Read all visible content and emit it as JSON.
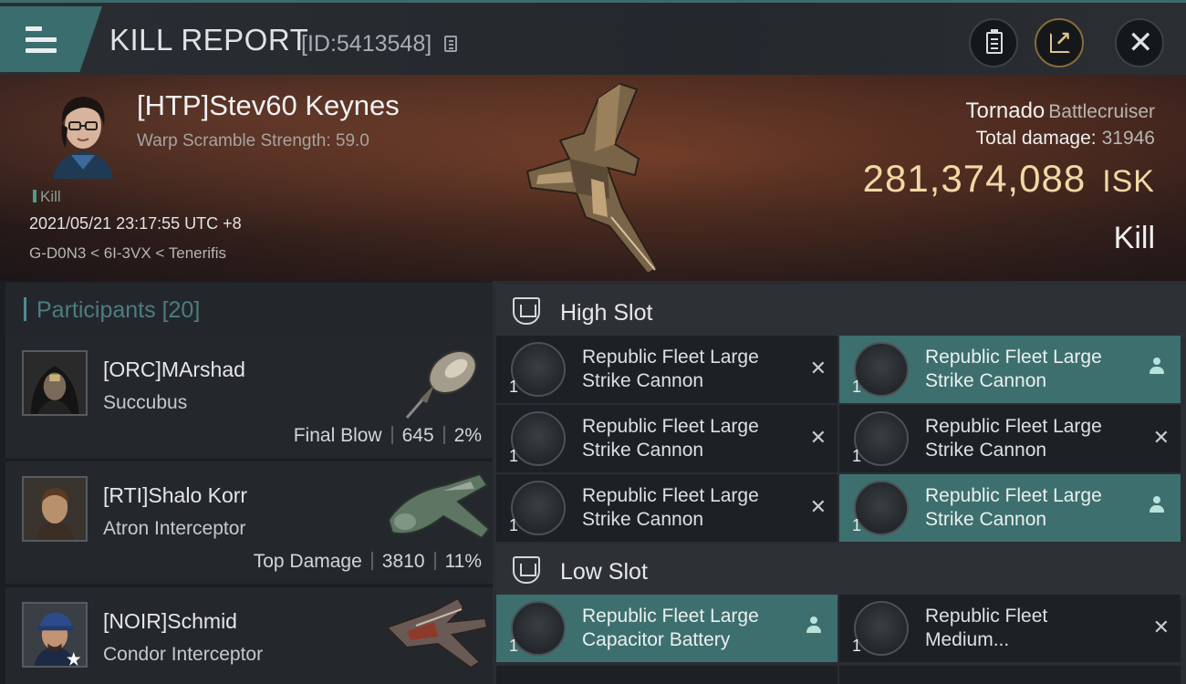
{
  "header": {
    "title": "KILL REPORT",
    "report_id": "[ID:5413548]"
  },
  "victim": {
    "pilot_name": "[HTP]Stev60 Keynes",
    "warp_scramble": "Warp Scramble Strength: 59.0",
    "tag": "Kill",
    "datetime": "2021/05/21 23:17:55 UTC +8",
    "location": "G-D0N3 < 6I-3VX < Tenerifis",
    "ship_name": "Tornado",
    "ship_class": "Battlecruiser",
    "total_damage_label": "Total damage:",
    "total_damage_value": "31946",
    "isk_value": "281,374,088",
    "isk_unit": "ISK",
    "result": "Kill"
  },
  "participants": {
    "label": "Participants",
    "count": "[20]",
    "rows": [
      {
        "name": "[ORC]MArshad",
        "ship": "Succubus",
        "role": "Final Blow",
        "damage": "645",
        "percent": "2%"
      },
      {
        "name": "[RTI]Shalo Korr",
        "ship": "Atron Interceptor",
        "role": "Top Damage",
        "damage": "3810",
        "percent": "11%"
      },
      {
        "name": "[NOIR]Schmid",
        "ship": "Condor Interceptor",
        "role": "",
        "damage": "",
        "percent": ""
      }
    ]
  },
  "fittings": {
    "high_slot": {
      "label": "High Slot",
      "modules": [
        {
          "name": "Republic Fleet Large Strike Cannon",
          "qty": "1",
          "state": "destroyed"
        },
        {
          "name": "Republic Fleet Large Strike Cannon",
          "qty": "1",
          "state": "dropped"
        },
        {
          "name": "Republic Fleet Large Strike Cannon",
          "qty": "1",
          "state": "destroyed"
        },
        {
          "name": "Republic Fleet Large Strike Cannon",
          "qty": "1",
          "state": "destroyed"
        },
        {
          "name": "Republic Fleet Large Strike Cannon",
          "qty": "1",
          "state": "destroyed"
        },
        {
          "name": "Republic Fleet Large Strike Cannon",
          "qty": "1",
          "state": "dropped"
        }
      ]
    },
    "low_slot": {
      "label": "Low Slot",
      "modules": [
        {
          "name": "Republic Fleet Large Capacitor Battery",
          "qty": "1",
          "state": "dropped"
        },
        {
          "name": "Republic Fleet Medium...",
          "qty": "1",
          "state": "destroyed"
        }
      ]
    }
  },
  "colors": {
    "accent_teal": "#3d6f6e",
    "isk_gold": "#f1d9a6",
    "participants_header": "#4c7d83"
  },
  "icons": {
    "menu": "hamburger-icon",
    "copy": "copy-icon",
    "clipboard": "clipboard-icon",
    "share": "share-icon",
    "close": "close-icon",
    "destroyed": "x-icon",
    "dropped": "person-icon",
    "slot": "shield-icon"
  }
}
